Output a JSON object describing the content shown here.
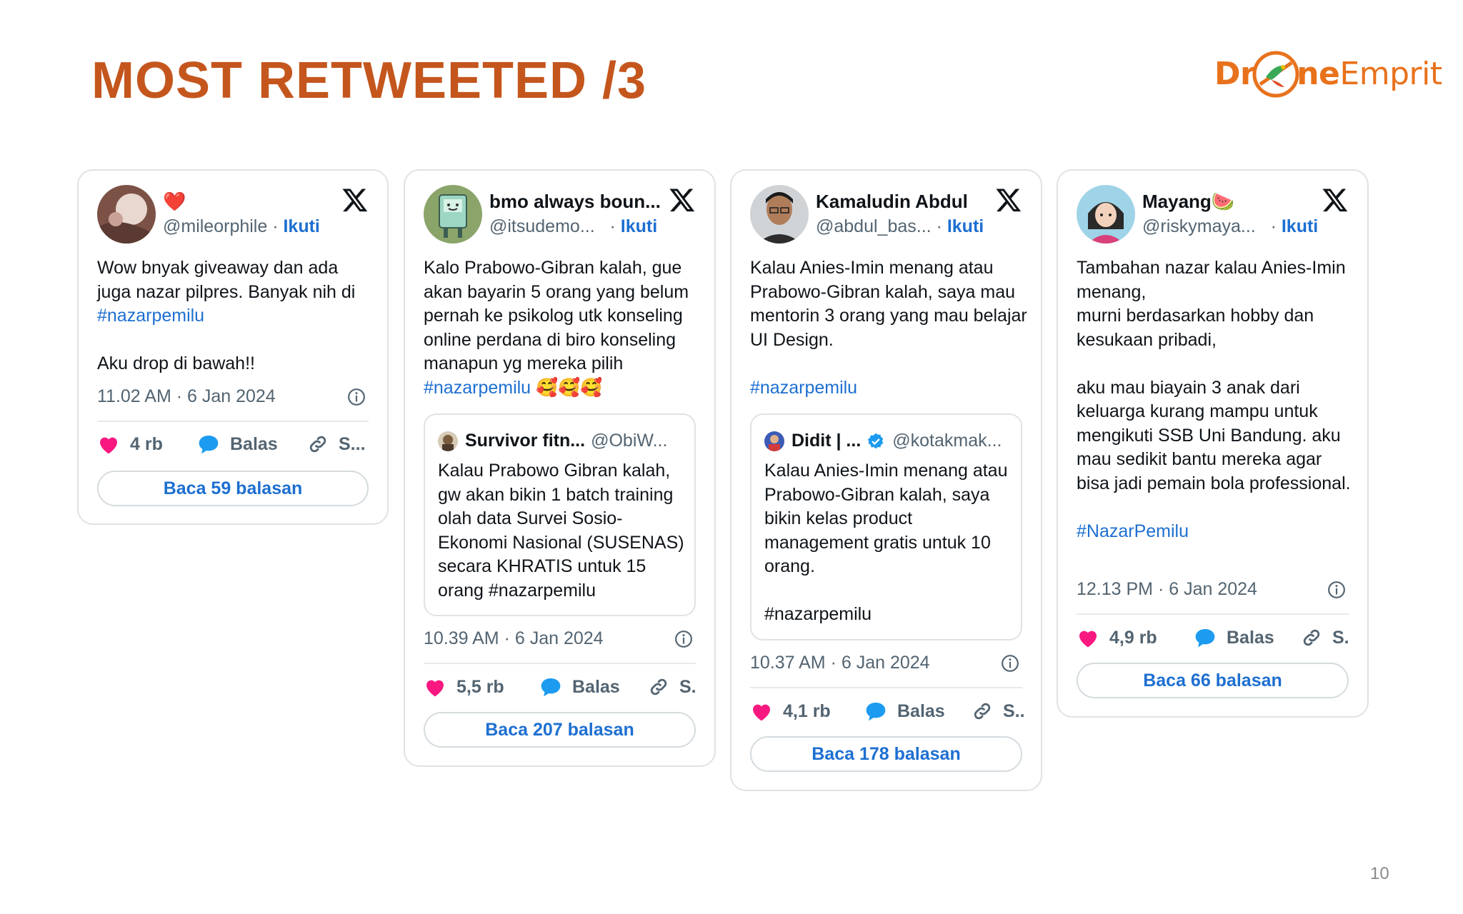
{
  "slide": {
    "title": "MOST RETWEETED /3",
    "page_number": "10"
  },
  "logo": {
    "prefix": "Dr",
    "suffix": "neEmprit",
    "suffix_light": "Emprit",
    "suffix_bold": "ne"
  },
  "colors": {
    "title": "#c4561d",
    "link": "#1d6fd1",
    "like": "#f91880",
    "reply": "#1d9bf0",
    "verified": "#1d9bf0"
  },
  "tweets": [
    {
      "name": "",
      "name_emoji": "❤️",
      "handle": "@mileorphile",
      "follow": "Ikuti",
      "text_lines": [
        "Wow bnyak giveaway dan ada juga nazar pilpres. Banyak nih di "
      ],
      "hashtag": "#nazarpemilu",
      "text_after": "\n\nAku drop di bawah!!",
      "timestamp": "11.02 AM · 6 Jan 2024",
      "likes": "4 rb",
      "reply_label": "Balas",
      "share_label": "S...",
      "read_replies": "Baca 59 balasan"
    },
    {
      "name": "bmo always boun...",
      "handle": "@itsudemo...",
      "follow": "Ikuti",
      "text": "Kalo Prabowo-Gibran kalah, gue akan bayarin 5 orang yang belum pernah ke psikolog utk konseling online perdana di biro konseling manapun yg mereka pilih\n",
      "hashtag": "#nazarpemilu",
      "emojis": "🥰🥰🥰",
      "quote": {
        "name": "Survivor fitn...",
        "handle": "@ObiW...",
        "text": "Kalau Prabowo Gibran kalah, gw akan bikin 1 batch training olah data Survei Sosio-Ekonomi Nasional (SUSENAS) secara KHRATIS untuk 15 orang #nazarpemilu"
      },
      "timestamp": "10.39 AM · 6 Jan 2024",
      "likes": "5,5 rb",
      "reply_label": "Balas",
      "share_label": "S.",
      "read_replies": "Baca 207 balasan"
    },
    {
      "name": "Kamaludin Abdul",
      "handle": "@abdul_bas...",
      "follow": "Ikuti",
      "text": "Kalau Anies-Imin menang atau Prabowo-Gibran kalah, saya mau mentorin 3 orang yang mau belajar UI Design.\n\n",
      "hashtag": "#nazarpemilu",
      "quote": {
        "name": "Didit | ...",
        "verified": true,
        "handle": "@kotakmak...",
        "text": "Kalau Anies-Imin menang atau Prabowo-Gibran kalah, saya bikin kelas product management gratis untuk 10 orang.\n\n#nazarpemilu"
      },
      "timestamp": "10.37 AM · 6 Jan 2024",
      "likes": "4,1 rb",
      "reply_label": "Balas",
      "share_label": "S..",
      "read_replies": "Baca 178 balasan"
    },
    {
      "name": "Mayang",
      "name_emoji": "🍉",
      "handle": "@riskymaya...",
      "follow": "Ikuti",
      "text": "Tambahan nazar kalau Anies-Imin menang,\nmurni berdasarkan hobby dan kesukaan pribadi,\n\naku mau biayain 3 anak dari keluarga kurang mampu untuk mengikuti SSB Uni Bandung. aku mau sedikit bantu mereka agar bisa jadi pemain bola professional.\n\n",
      "hashtag": "#NazarPemilu",
      "timestamp": "12.13 PM · 6 Jan 2024",
      "likes": "4,9 rb",
      "reply_label": "Balas",
      "share_label": "S.",
      "read_replies": "Baca 66 balasan"
    }
  ]
}
